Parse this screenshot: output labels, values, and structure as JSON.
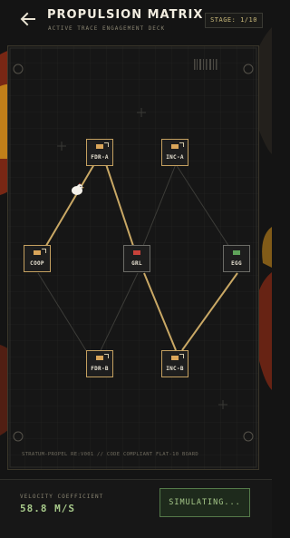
{
  "header": {
    "title": "PROPULSION MATRIX",
    "subtitle": "ACTIVE TRACE ENGAGEMENT DECK",
    "stage": "STAGE: 1/10"
  },
  "board": {
    "nodes": [
      {
        "id": "FDR-A",
        "label": "FDR-A",
        "chip_color": "#d9a55a"
      },
      {
        "id": "INC-A",
        "label": "INC-A",
        "chip_color": "#d9a55a"
      },
      {
        "id": "COOP",
        "label": "COOP",
        "chip_color": "#d9a55a"
      },
      {
        "id": "GRL",
        "label": "GRL",
        "chip_color": "#c8423a"
      },
      {
        "id": "EGG",
        "label": "EGG",
        "chip_color": "#5fa35a"
      },
      {
        "id": "FDR-B",
        "label": "FDR-B",
        "chip_color": "#d9a55a"
      },
      {
        "id": "INC-B",
        "label": "INC-B",
        "chip_color": "#d9a55a"
      }
    ],
    "footer": "STRATUM-PROPEL RE:V001 // CODE COMPLIANT FLAT-10 BOARD"
  },
  "status": {
    "velocity_label": "VELOCITY COEFFICIENT",
    "velocity_value": "58.8 M/S",
    "simulate_button": "SIMULATING..."
  },
  "colors": {
    "active_trace": "#c9a865",
    "inactive_trace": "#3c3c38",
    "accent_green": "#a7c98a",
    "accent_gold": "#c4a060"
  }
}
